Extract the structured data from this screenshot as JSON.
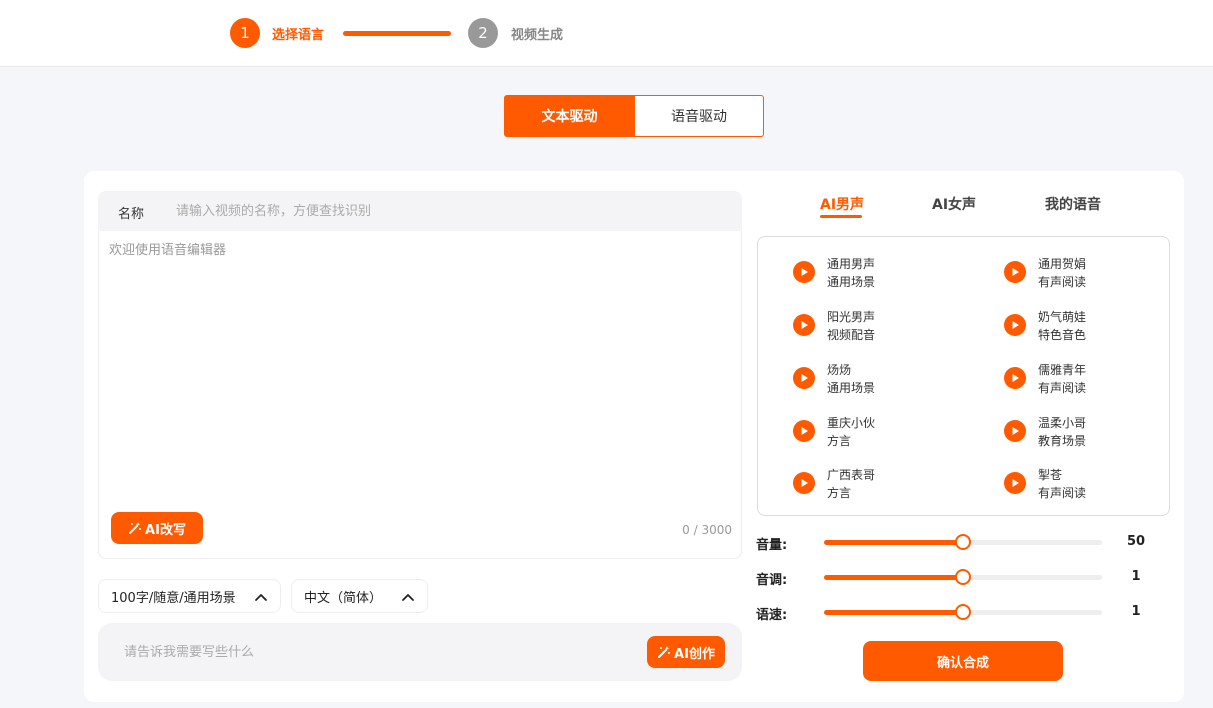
{
  "stepper": {
    "step1": {
      "number": "1",
      "label": "选择语言"
    },
    "step2": {
      "number": "2",
      "label": "视频生成"
    }
  },
  "mode_tabs": {
    "text_driven": "文本驱动",
    "voice_driven": "语音驱动"
  },
  "editor": {
    "name_label": "名称",
    "name_placeholder": "请输入视频的名称，方便查找识别",
    "content_placeholder": "欢迎使用语音编辑器",
    "ai_rewrite_label": "AI改写",
    "char_count": "0 / 3000"
  },
  "options": {
    "length_style": "100字/随意/通用场景",
    "language": "中文（简体）"
  },
  "prompt": {
    "placeholder": "请告诉我需要写些什么",
    "ai_create_label": "AI创作"
  },
  "voice_tabs": {
    "male": "AI男声",
    "female": "AI女声",
    "mine": "我的语音"
  },
  "voices": [
    {
      "name": "通用男声",
      "tag": "通用场景"
    },
    {
      "name": "通用贺娟",
      "tag": "有声阅读"
    },
    {
      "name": "阳光男声",
      "tag": "视频配音"
    },
    {
      "name": "奶气萌娃",
      "tag": "特色音色"
    },
    {
      "name": "炀炀",
      "tag": "通用场景"
    },
    {
      "name": "儒雅青年",
      "tag": "有声阅读"
    },
    {
      "name": "重庆小伙",
      "tag": "方言"
    },
    {
      "name": "温柔小哥",
      "tag": "教育场景"
    },
    {
      "name": "广西表哥",
      "tag": "方言"
    },
    {
      "name": "掣苍",
      "tag": "有声阅读"
    }
  ],
  "sliders": {
    "volume": {
      "label": "音量:",
      "value": "50",
      "level": 0.5
    },
    "pitch": {
      "label": "音调:",
      "value": "1",
      "level": 0.5
    },
    "speed": {
      "label": "语速:",
      "value": "1",
      "level": 0.5
    }
  },
  "confirm_label": "确认合成",
  "colors": {
    "accent": "#ff5a00",
    "inactive_step": "#999999"
  }
}
